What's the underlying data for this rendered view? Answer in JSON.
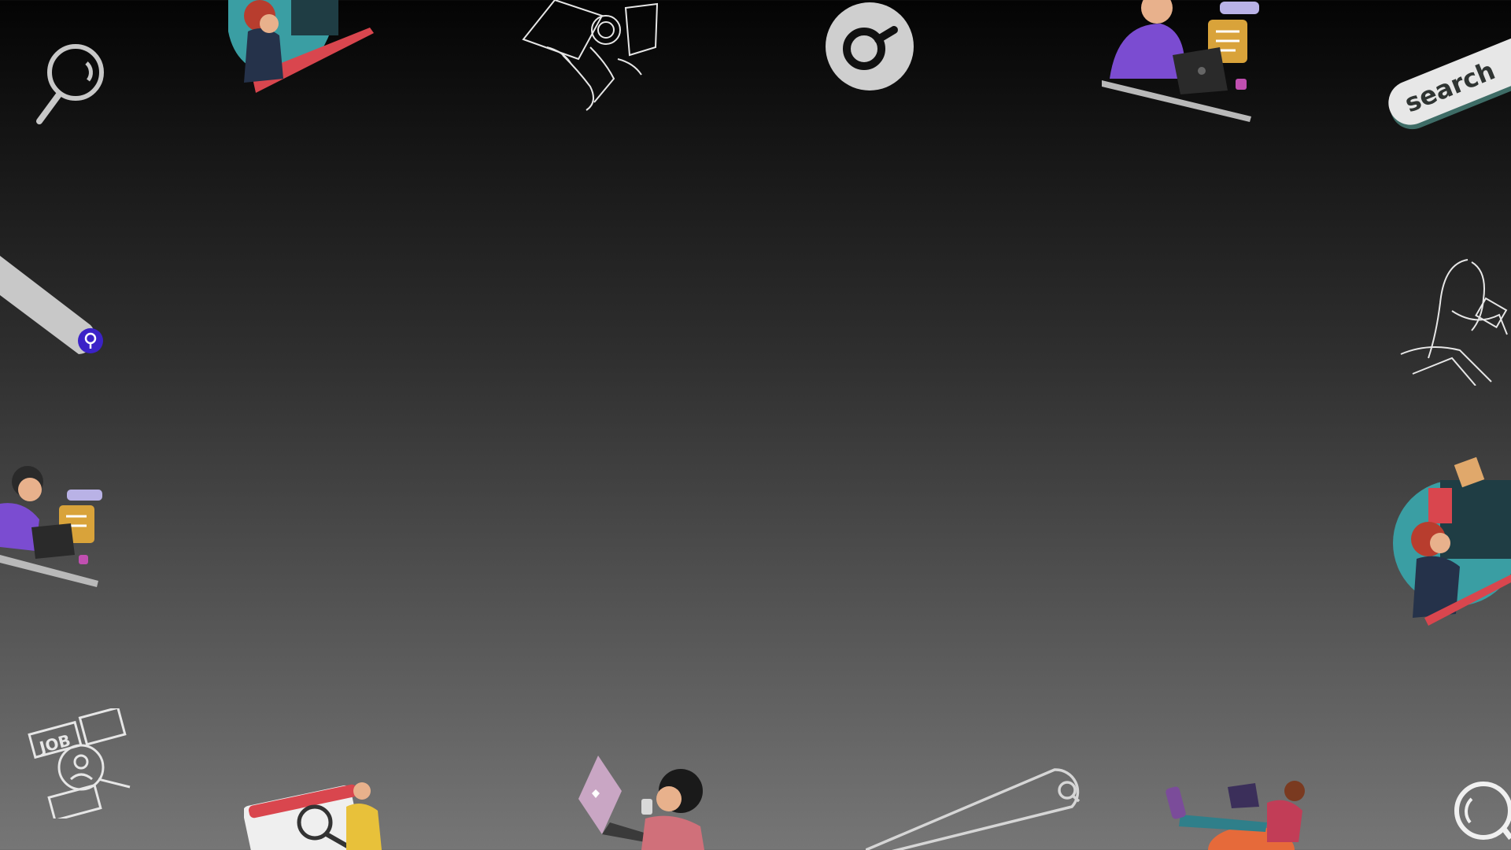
{
  "decor": {
    "search_chip_text": "search",
    "job_card_text": "JOB"
  },
  "colors": {
    "bg_top": "#040404",
    "bg_bottom": "#767676",
    "light_gray": "#c8c8c8",
    "accent_blue": "#3b22c7",
    "teal": "#3a9ea3",
    "coral": "#d9464e",
    "purple": "#7b4cd1"
  }
}
